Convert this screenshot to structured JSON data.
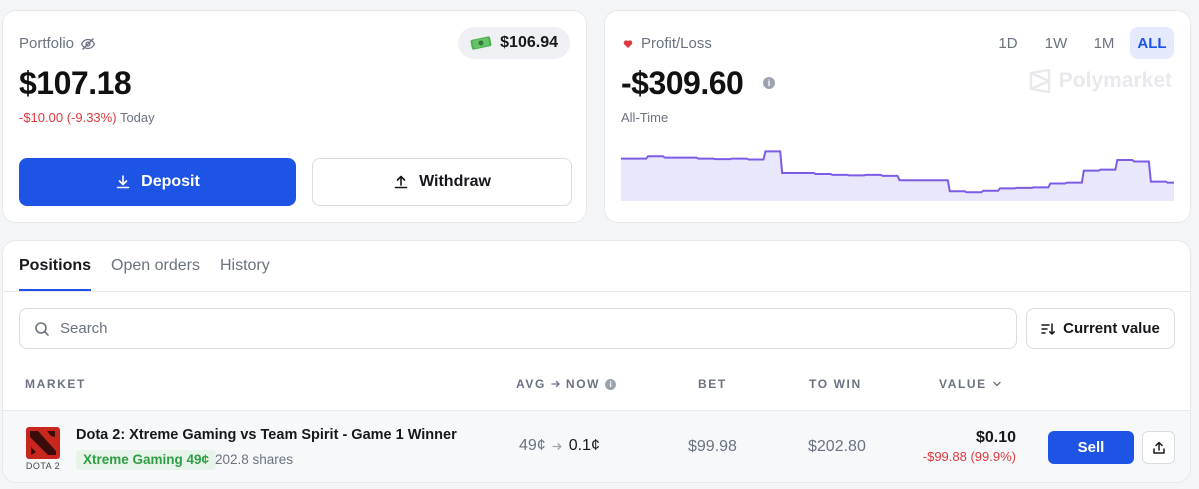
{
  "portfolio": {
    "label": "Portfolio",
    "value": "$107.18",
    "change": "-$10.00 (-9.33%)",
    "change_period": "Today",
    "cash": "$106.94",
    "deposit_label": "Deposit",
    "withdraw_label": "Withdraw"
  },
  "pnl": {
    "label": "Profit/Loss",
    "value": "-$309.60",
    "period": "All-Time",
    "watermark": "Polymarket",
    "ranges": [
      "1D",
      "1W",
      "1M",
      "ALL"
    ],
    "active_range": "ALL",
    "colors": {
      "line": "#7c5ce6",
      "fill": "#e9e7fb"
    },
    "chart_data": {
      "type": "area",
      "series": [
        {
          "values": [
            0.8,
            0.8,
            0.85,
            0.82,
            0.82,
            0.8,
            0.79,
            0.8,
            0.78,
            0.95,
            0.5,
            0.5,
            0.48,
            0.46,
            0.45,
            0.46,
            0.44,
            0.35,
            0.35,
            0.35,
            0.12,
            0.1,
            0.13,
            0.18,
            0.19,
            0.2,
            0.28,
            0.3,
            0.55,
            0.57,
            0.77,
            0.74,
            0.32,
            0.3
          ]
        }
      ]
    }
  },
  "positions": {
    "tabs": [
      "Positions",
      "Open orders",
      "History"
    ],
    "active_tab": "Positions",
    "search_placeholder": "Search",
    "sort_label": "Current value",
    "columns": {
      "market": "MARKET",
      "avg_now_a": "AVG",
      "avg_now_b": "NOW",
      "bet": "BET",
      "to_win": "TO WIN",
      "value": "VALUE"
    },
    "rows": [
      {
        "icon_text": "DOTA 2",
        "title": "Dota 2: Xtreme Gaming vs Team Spirit - Game 1 Winner",
        "outcome": "Xtreme Gaming 49¢",
        "shares": "202.8 shares",
        "avg": "49¢",
        "now": "0.1¢",
        "bet": "$99.98",
        "to_win": "$202.80",
        "value": "$0.10",
        "value_change": "-$99.88 (99.9%)",
        "sell_label": "Sell"
      }
    ]
  }
}
